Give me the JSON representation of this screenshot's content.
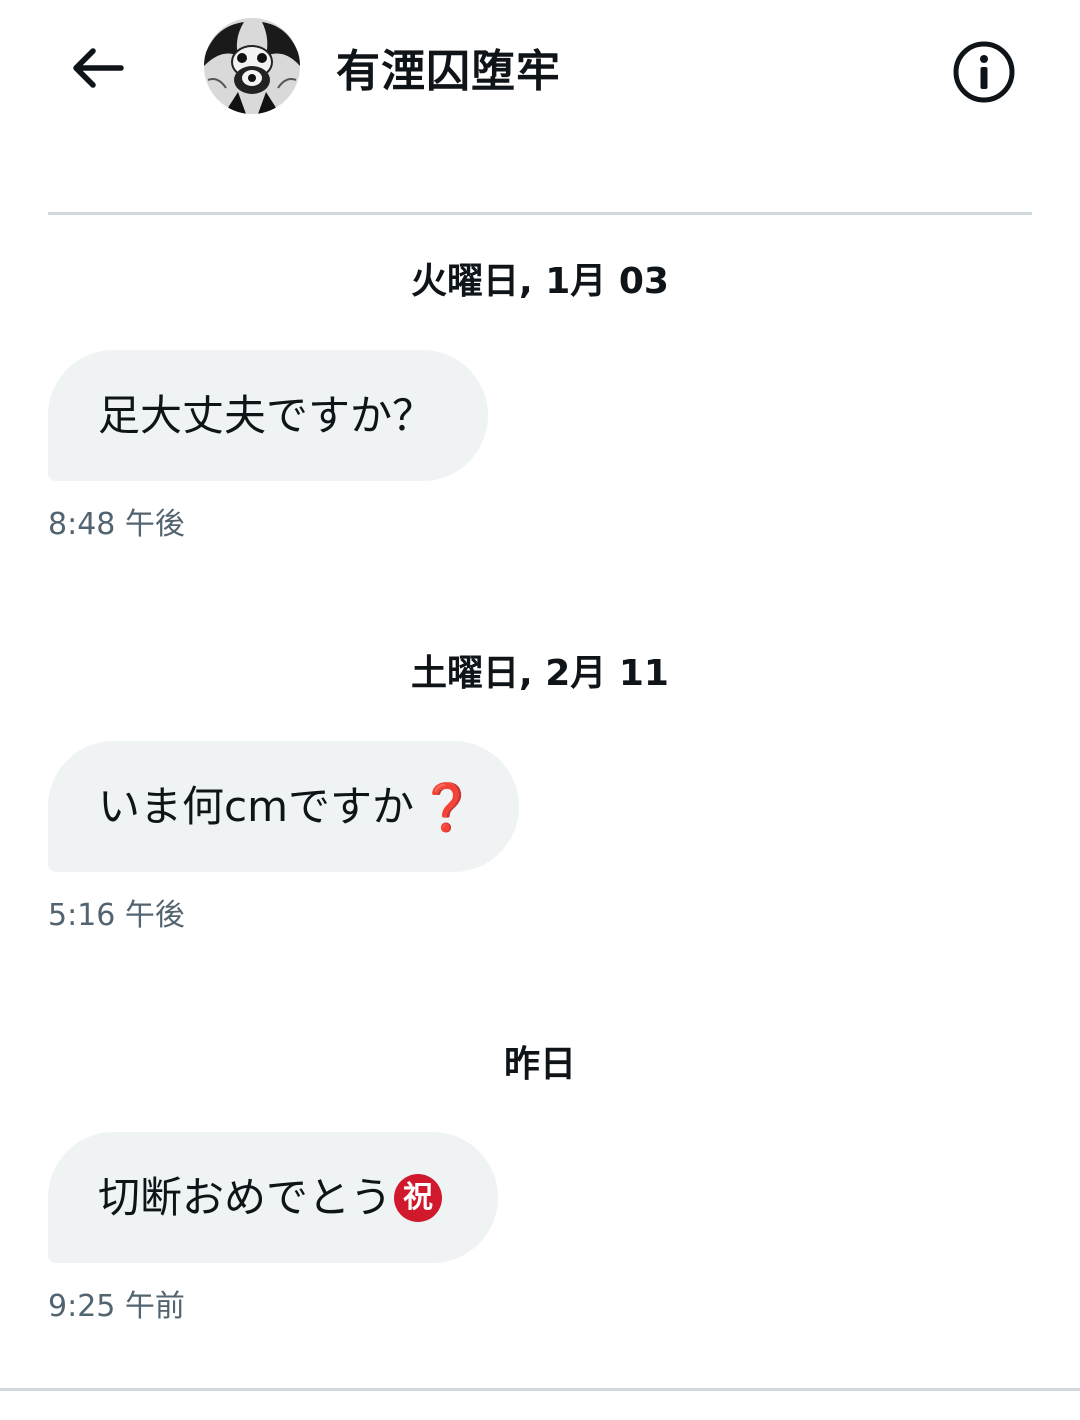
{
  "header": {
    "contact_name": "有湮囚堕牢",
    "back_icon": "arrow-left-icon",
    "info_icon": "info-circle-icon",
    "avatar": "contact-avatar"
  },
  "conversation": [
    {
      "date": "火曜日, 1月 03",
      "message_text": "足大丈夫ですか？",
      "emoji": "",
      "time": "8:48 午後"
    },
    {
      "date": "土曜日, 2月 11",
      "message_text": "いま何cmですか",
      "emoji": "❓",
      "time": "5:16 午後"
    },
    {
      "date": "昨日",
      "message_text": "切断おめでとう",
      "emoji": "祝",
      "time": "9:25 午前"
    }
  ],
  "colors": {
    "bubble_bg": "#eff3f4",
    "divider": "#cfd9de",
    "timestamp": "#536471",
    "emoji_red": "#d0192c"
  }
}
